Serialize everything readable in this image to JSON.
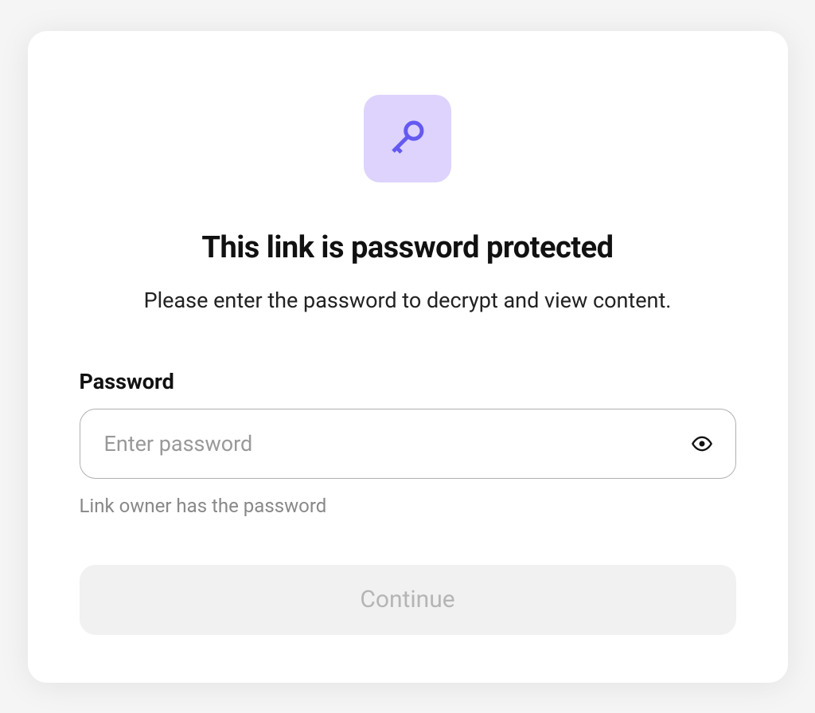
{
  "card": {
    "title": "This link is password protected",
    "subtitle": "Please enter the password to decrypt and view content.",
    "password": {
      "label": "Password",
      "placeholder": "Enter password",
      "hint": "Link owner has the password"
    },
    "continue_label": "Continue"
  }
}
